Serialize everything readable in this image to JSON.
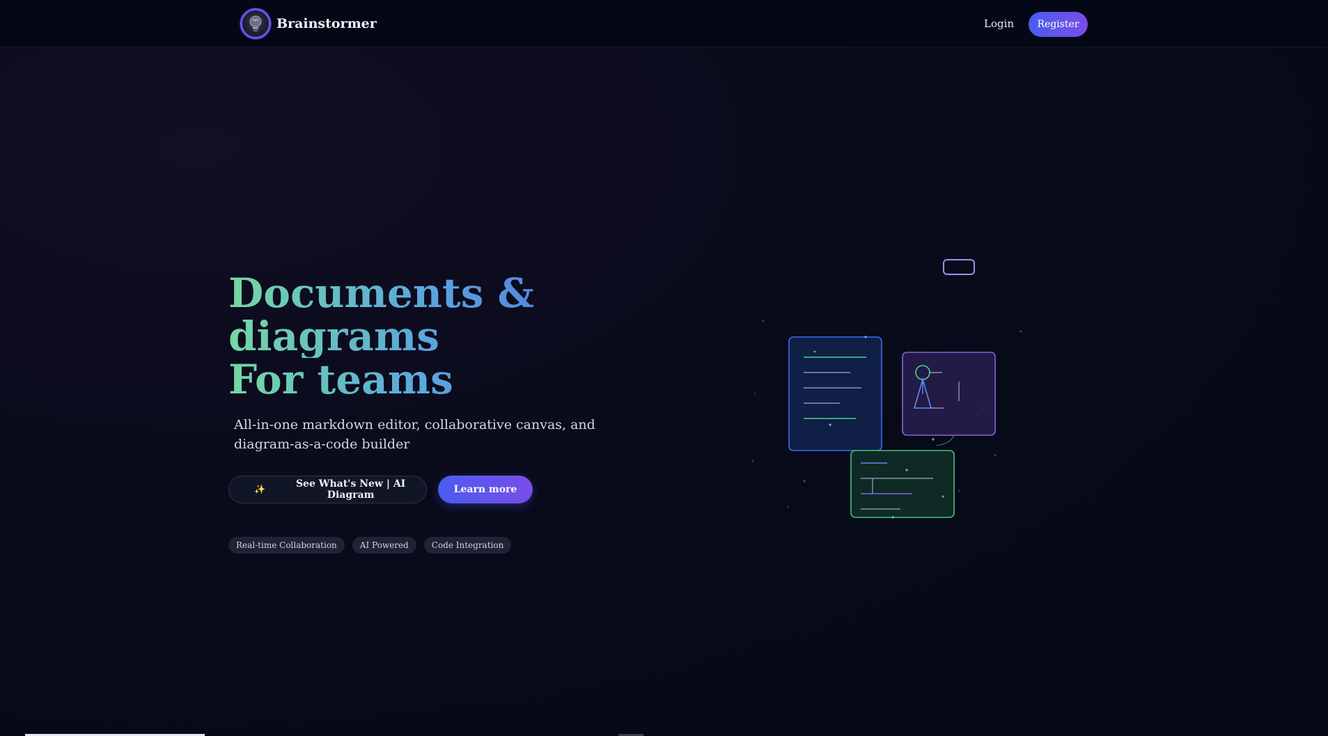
{
  "nav": {
    "brand_name": "Brainstormer",
    "login_label": "Login",
    "register_label": "Register"
  },
  "hero": {
    "title_lines": [
      "Documents &",
      "diagrams",
      "For teams"
    ],
    "subtitle": "All-in-one markdown editor, collaborative canvas, and diagram-as-a-code builder",
    "whats_new_label": "See What's New | AI Diagram",
    "learn_more_label": "Learn more",
    "tags": [
      "Real-time Collaboration",
      "AI Powered",
      "Code Integration"
    ]
  },
  "icons": {
    "logo": "lightbulb-brain-icon",
    "whats_new": "sparkles-icon"
  },
  "colors": {
    "background": "#050817",
    "accent_start": "#4a5cf0",
    "accent_end": "#7a4de6",
    "gradient_green": "#73d9a3",
    "gradient_blue": "#5064e6"
  }
}
